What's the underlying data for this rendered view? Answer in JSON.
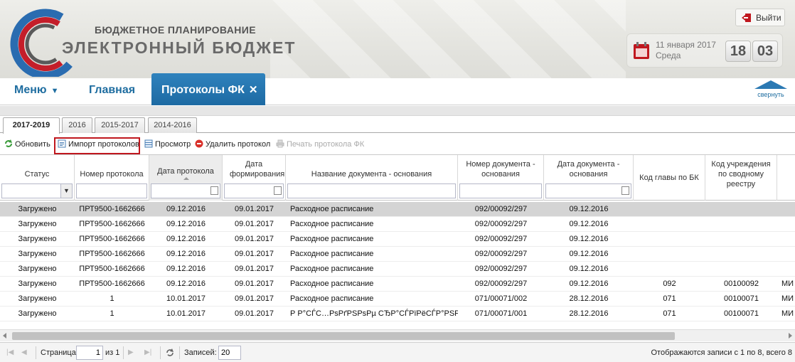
{
  "header": {
    "brand_line1": "БЮДЖЕТНОЕ ПЛАНИРОВАНИЕ",
    "brand_line2": "ЭЛЕКТРОННЫЙ БЮДЖЕТ",
    "exit_label": "Выйти",
    "date": "11 января 2017",
    "weekday": "Среда",
    "clock_hours": "18",
    "clock_minutes": "03"
  },
  "nav": {
    "menu_label": "Меню",
    "menu_caret": "▼",
    "home_label": "Главная",
    "active_tab_label": "Протоколы ФК",
    "close_glyph": "✕",
    "collapse_label": "свернуть"
  },
  "year_tabs": [
    "2017-2019",
    "2016",
    "2015-2017",
    "2014-2016"
  ],
  "toolbar": {
    "refresh": "Обновить",
    "import": "Импорт протоколов",
    "view": "Просмотр",
    "delete": "Удалить протокол",
    "print": "Печать протокола ФК"
  },
  "grid": {
    "columns": [
      "Статус",
      "Номер протокола",
      "Дата протокола",
      "Дата формирования",
      "Название документа - основания",
      "Номер документа - основания",
      "Дата документа - основания",
      "Код главы по БК",
      "Код учреждения по сводному реестру"
    ],
    "rows": [
      [
        "Загружено",
        "ПРТ9500-1662666",
        "09.12.2016",
        "09.01.2017",
        "Расходное расписание",
        "092/00092/297",
        "09.12.2016",
        "",
        "",
        ""
      ],
      [
        "Загружено",
        "ПРТ9500-1662666",
        "09.12.2016",
        "09.01.2017",
        "Расходное расписание",
        "092/00092/297",
        "09.12.2016",
        "",
        "",
        ""
      ],
      [
        "Загружено",
        "ПРТ9500-1662666",
        "09.12.2016",
        "09.01.2017",
        "Расходное расписание",
        "092/00092/297",
        "09.12.2016",
        "",
        "",
        ""
      ],
      [
        "Загружено",
        "ПРТ9500-1662666",
        "09.12.2016",
        "09.01.2017",
        "Расходное расписание",
        "092/00092/297",
        "09.12.2016",
        "",
        "",
        ""
      ],
      [
        "Загружено",
        "ПРТ9500-1662666",
        "09.12.2016",
        "09.01.2017",
        "Расходное расписание",
        "092/00092/297",
        "09.12.2016",
        "",
        "",
        ""
      ],
      [
        "Загружено",
        "ПРТ9500-1662666",
        "09.12.2016",
        "09.01.2017",
        "Расходное расписание",
        "092/00092/297",
        "09.12.2016",
        "092",
        "00100092",
        "МИ"
      ],
      [
        "Загружено",
        "1",
        "10.01.2017",
        "09.01.2017",
        "Расходное расписание",
        "071/00071/002",
        "28.12.2016",
        "071",
        "00100071",
        "МИ"
      ],
      [
        "Загружено",
        "1",
        "10.01.2017",
        "09.01.2017",
        "Р Р°СЃС…РѕРґРЅРѕРµ СЂР°СЃРїРёСЃР°РЅРёРµ",
        "071/00071/001",
        "28.12.2016",
        "071",
        "00100071",
        "МИ"
      ]
    ]
  },
  "pager": {
    "page_label": "Страница",
    "page_value": "1",
    "of_label": "из 1",
    "records_label": "Записей:",
    "records_value": "20",
    "summary": "Отображаются записи с 1 по 8, всего 8"
  },
  "colors": {
    "accent_blue": "#1e6da0",
    "active_tab": "#2b79b3",
    "highlight_red": "#c0171e",
    "selected_row": "#d4d4d4"
  }
}
